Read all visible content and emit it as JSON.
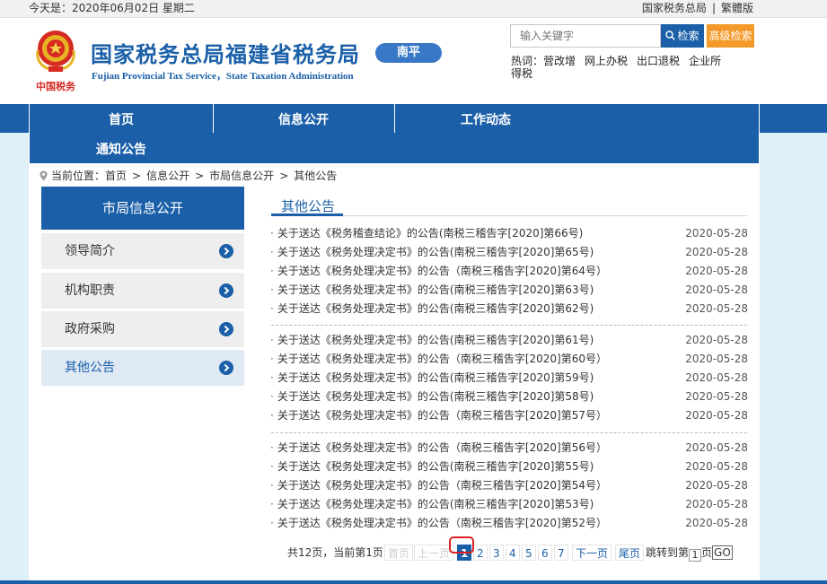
{
  "topbar": {
    "date_text": "今天是：2020年06月02日 星期二",
    "link_main": "国家税务总局",
    "separator": "|",
    "link_traditional": "繁體版"
  },
  "header": {
    "site_title": "国家税务总局福建省税务局",
    "site_subtitle_en": "Fujian Provincial Tax Service，State Taxation Administration",
    "logo_text": "中国税务",
    "region_badge": "南平",
    "search_placeholder": "输入关键字",
    "search_button": "检索",
    "advanced_search": "高级检索",
    "hotwords_label": "热词：",
    "hotwords": [
      "营改增",
      "网上办税",
      "出口退税",
      "企业所得税"
    ]
  },
  "nav": {
    "items": [
      "首页",
      "信息公开",
      "工作动态",
      "通知公告"
    ]
  },
  "breadcrumb": {
    "prefix": "当前位置：",
    "items": [
      "首页",
      "信息公开",
      "市局信息公开",
      "其他公告"
    ],
    "separator": ">"
  },
  "sidebar": {
    "title": "市局信息公开",
    "items": [
      {
        "label": "领导简介",
        "active": false
      },
      {
        "label": "机构职责",
        "active": false
      },
      {
        "label": "政府采购",
        "active": false
      },
      {
        "label": "其他公告",
        "active": true
      }
    ]
  },
  "content": {
    "section_title": "其他公告",
    "bullet": "·",
    "groups": [
      [
        {
          "title": "关于送达《税务稽查结论》的公告(南税三稽告字[2020]第66号)",
          "date": "2020-05-28"
        },
        {
          "title": "关于送达《税务处理决定书》的公告(南税三稽告字[2020]第65号)",
          "date": "2020-05-28"
        },
        {
          "title": "关于送达《税务处理决定书》的公告（南税三稽告字[2020]第64号）",
          "date": "2020-05-28"
        },
        {
          "title": "关于送达《税务处理决定书》的公告(南税三稽告字[2020]第63号)",
          "date": "2020-05-28"
        },
        {
          "title": "关于送达《税务处理决定书》的公告(南税三稽告字[2020]第62号)",
          "date": "2020-05-28"
        }
      ],
      [
        {
          "title": "关于送达《税务处理决定书》的公告(南税三稽告字[2020]第61号)",
          "date": "2020-05-28"
        },
        {
          "title": "关于送达《税务处理决定书》的公告（南税三稽告字[2020]第60号）",
          "date": "2020-05-28"
        },
        {
          "title": "关于送达《税务处理决定书》的公告(南税三稽告字[2020]第59号)",
          "date": "2020-05-28"
        },
        {
          "title": "关于送达《税务处理决定书》的公告(南税三稽告字[2020]第58号)",
          "date": "2020-05-28"
        },
        {
          "title": "关于送达《税务处理决定书》的公告（南税三稽告字[2020]第57号）",
          "date": "2020-05-28"
        }
      ],
      [
        {
          "title": "关于送达《税务处理决定书》的公告（南税三稽告字[2020]第56号）",
          "date": "2020-05-28"
        },
        {
          "title": "关于送达《税务处理决定书》的公告(南税三稽告字[2020]第55号)",
          "date": "2020-05-28"
        },
        {
          "title": "关于送达《税务处理决定书》的公告（南税三稽告字[2020]第54号）",
          "date": "2020-05-28"
        },
        {
          "title": "关于送达《税务处理决定书》的公告(南税三稽告字[2020]第53号)",
          "date": "2020-05-28"
        },
        {
          "title": "关于送达《税务处理决定书》的公告（南税三稽告字[2020]第52号）",
          "date": "2020-05-28"
        }
      ]
    ]
  },
  "pagination": {
    "summary": "共12页，当前第1页",
    "first": "首页",
    "prev": "上一页",
    "pages": [
      "1",
      "2",
      "3",
      "4",
      "5",
      "6",
      "7"
    ],
    "current_page": "1",
    "next": "下一页",
    "last": "尾页",
    "jump_label": "跳转到第",
    "jump_value": "1",
    "jump_suffix": "页",
    "go": "GO"
  },
  "colors": {
    "primary": "#1a5fa8",
    "accent_orange": "#f39a2a",
    "page_bg": "#dff0f8",
    "highlight_red": "#e02020"
  }
}
